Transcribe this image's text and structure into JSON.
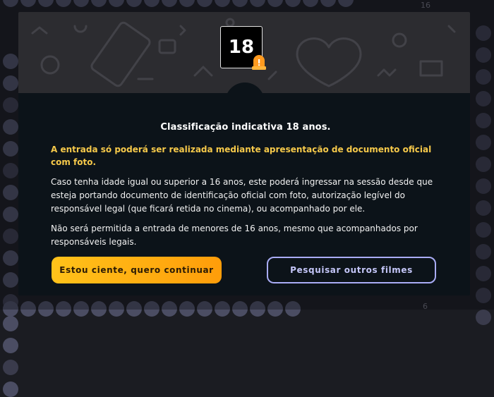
{
  "background": {
    "row_numbers": [
      "16",
      "6"
    ]
  },
  "modal": {
    "rating_badge": "18",
    "title": "Classificação indicativa 18 anos.",
    "warning": "A entrada só poderá ser realizada mediante apresentação de documento oficial com foto.",
    "paragraphs": [
      "Caso tenha idade igual ou superior a 16 anos, este poderá ingressar na sessão desde que esteja portando documento de identificação oficial com foto, autorização legível do responsável legal (que ficará retida no cinema), ou acompanhado por ele.",
      "Não será permitida a entrada de menores de 16 anos, mesmo que acompanhados por responsáveis legais."
    ],
    "buttons": {
      "continue_label": "Estou ciente, quero continuar",
      "search_label": "Pesquisar outros filmes"
    }
  },
  "colors": {
    "accent_yellow": "#f6c94a",
    "button_gradient_start": "#ffc21a",
    "button_gradient_end": "#ff9d0a",
    "secondary_border": "#a9acf5",
    "modal_background": "#0c1319"
  },
  "icons": {
    "rating_warning": "warning-siren-icon"
  }
}
